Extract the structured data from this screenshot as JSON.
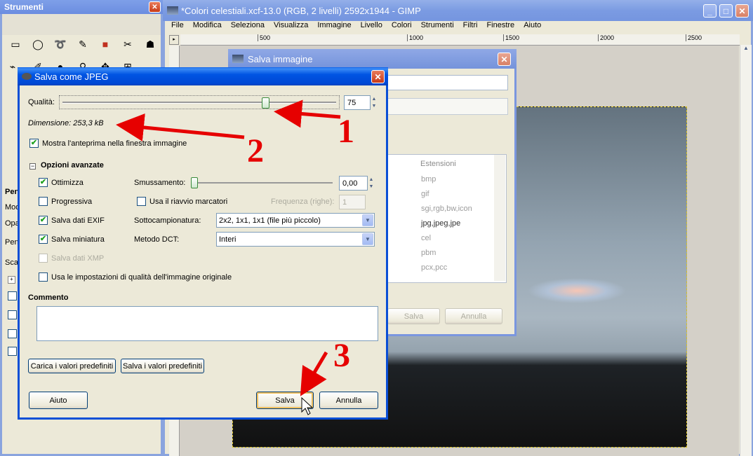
{
  "toolbox": {
    "title": "Strumenti",
    "left_labels": [
      "Penn",
      "Modo",
      "Opac",
      "Penn",
      "Scala"
    ]
  },
  "gimp": {
    "title": "*Colori celestiali.xcf-13.0 (RGB, 2 livelli) 2592x1944 - GIMP",
    "menu": [
      "File",
      "Modifica",
      "Seleziona",
      "Visualizza",
      "Immagine",
      "Livello",
      "Colori",
      "Strumenti",
      "Filtri",
      "Finestre",
      "Aiuto"
    ],
    "ruler": [
      "500",
      "1000",
      "1500",
      "2000",
      "2500"
    ]
  },
  "save_image": {
    "title": "Salva immagine",
    "col_header": "Estensioni",
    "extensions": [
      "bmp",
      "gif",
      "sgi,rgb,bw,icon",
      "jpg,jpeg,jpe",
      "cel",
      "pbm",
      "pcx,pcc"
    ],
    "save": "Salva",
    "cancel": "Annulla"
  },
  "jpeg": {
    "title": "Salva come JPEG",
    "quality_label": "Qualità:",
    "quality_value": "75",
    "quality_fraction": 0.75,
    "size": "Dimensione: 253,3 kB",
    "preview": "Mostra l'anteprima nella finestra immagine",
    "advanced": "Opzioni avanzate",
    "optimize": "Ottimizza",
    "smoothing_label": "Smussamento:",
    "smoothing_value": "0,00",
    "progressive": "Progressiva",
    "restart": "Usa il riavvio marcatori",
    "frequency_label": "Frequenza (righe):",
    "frequency_value": "1",
    "exif": "Salva dati EXIF",
    "subsampling_label": "Sottocampionatura:",
    "subsampling_value": "2x2, 1x1, 1x1 (file più piccolo)",
    "thumbnail": "Salva miniatura",
    "dct_label": "Metodo DCT:",
    "dct_value": "Interi",
    "xmp": "Salva dati XMP",
    "original_quality": "Usa le impostazioni di qualità dell'immagine originale",
    "comment_label": "Commento",
    "load_defaults": "Carica i valori predefiniti",
    "save_defaults": "Salva i valori predefiniti",
    "help": "Aiuto",
    "save": "Salva",
    "cancel": "Annulla"
  },
  "annotations": [
    "1",
    "2",
    "3"
  ]
}
